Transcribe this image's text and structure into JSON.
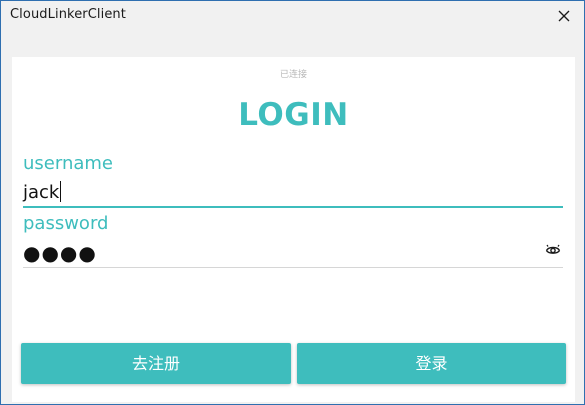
{
  "window": {
    "title": "CloudLinkerClient",
    "close_icon": "close-icon"
  },
  "status": {
    "text": "已连接"
  },
  "form": {
    "heading": "LOGIN",
    "username_label": "username",
    "username_value": "jack",
    "password_label": "password",
    "password_masked": "●●●●",
    "eye_icon": "eye-icon"
  },
  "buttons": {
    "register_label": "去注册",
    "login_label": "登录"
  },
  "colors": {
    "accent": "#3ebdbd",
    "window_border": "#2f6fb0"
  }
}
